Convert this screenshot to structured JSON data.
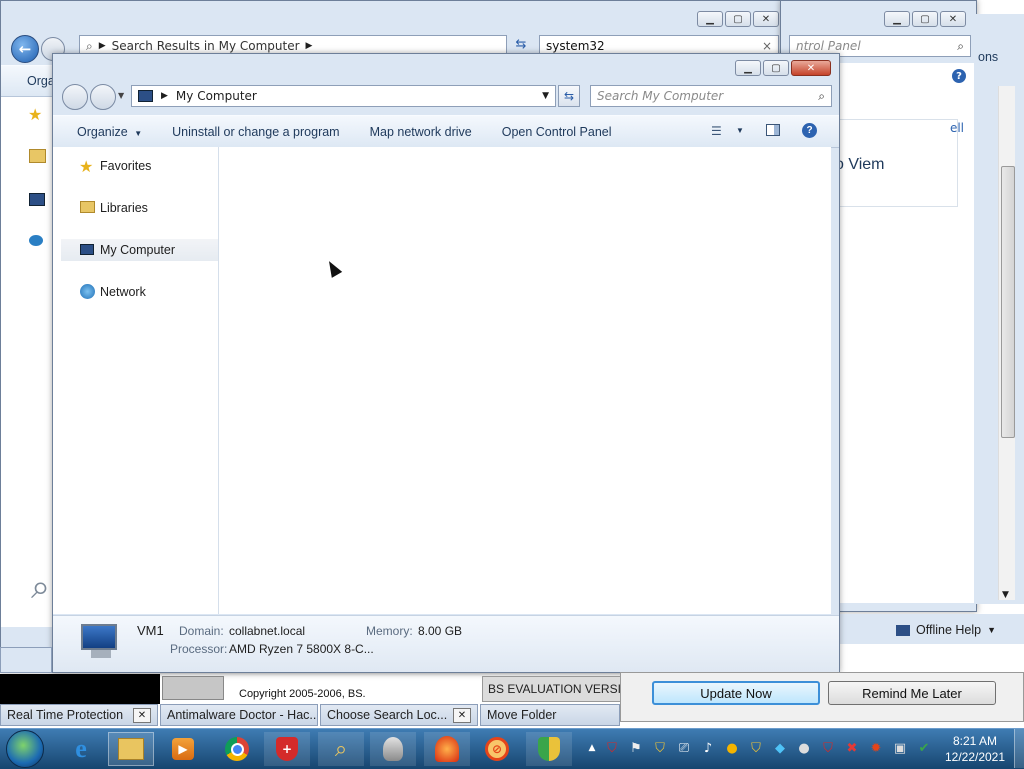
{
  "back_window_left": {
    "address_path": "Search Results in My Computer",
    "search_value": "system32",
    "organize_label": "Orga"
  },
  "back_window_right": {
    "search_placeholder": "ntrol Panel",
    "options_label": "ons",
    "partial_heading": "o Viem",
    "partial_link": "ell",
    "offline_help_label": "Offline Help"
  },
  "explorer": {
    "address_path": "My Computer",
    "search_placeholder": "Search My Computer",
    "toolbar": {
      "organize": "Organize",
      "uninstall": "Uninstall or change a program",
      "map_drive": "Map network drive",
      "control_panel": "Open Control Panel"
    },
    "nav": [
      {
        "label": "Favorites",
        "icon": "star-icon"
      },
      {
        "label": "Libraries",
        "icon": "folder-icon"
      },
      {
        "label": "My Computer",
        "icon": "computer-icon"
      },
      {
        "label": "Network",
        "icon": "network-icon"
      }
    ],
    "details": {
      "computer_name": "VM1",
      "domain_label": "Domain:",
      "domain_value": "collabnet.local",
      "memory_label": "Memory:",
      "memory_value": "8.00 GB",
      "processor_label": "Processor:",
      "processor_value": "AMD Ryzen 7 5800X 8-C..."
    }
  },
  "background_texts": {
    "copyright": "Copyright 2005-2006, BS.",
    "eval_version": "BS EVALUATION VERSION"
  },
  "update_dialog": {
    "update_now": "Update Now",
    "remind_later": "Remind Me Later"
  },
  "taskbar": {
    "windows": [
      {
        "label": "Real Time Protection",
        "has_close": true
      },
      {
        "label": "Antimalware Doctor - Hac...",
        "has_close": false
      },
      {
        "label": "Choose Search Loc...",
        "has_close": true
      },
      {
        "label": "Move Folder",
        "has_close": false
      }
    ],
    "pinned": [
      "start-orb-icon",
      "internet-explorer-icon",
      "file-explorer-icon",
      "media-player-icon",
      "chrome-icon",
      "antimalware-shield-icon",
      "search-scanner-icon",
      "robot-icon",
      "alarm-icon",
      "no-virus-icon",
      "security-shield-icon"
    ],
    "clock_time": "8:21 AM",
    "clock_date": "12/22/2021"
  },
  "colors": {
    "accent": "#1e395b",
    "taskbar": "#1d5a8c",
    "close_red": "#c5432a"
  }
}
